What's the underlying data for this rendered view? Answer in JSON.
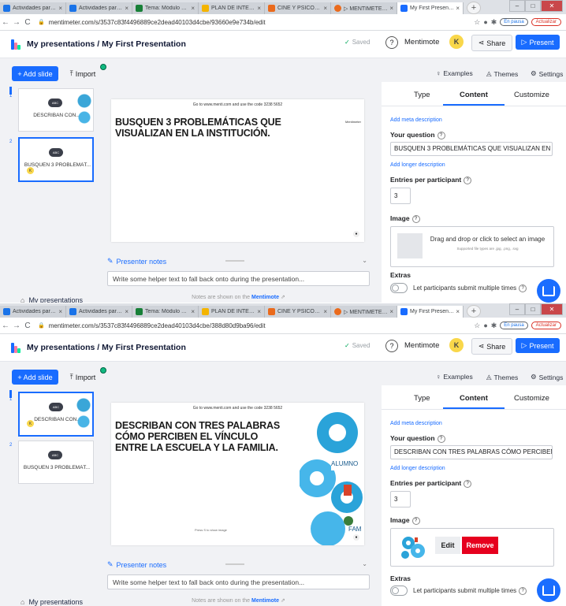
{
  "browser": {
    "tabs": [
      {
        "label": "Actividades para ...",
        "color": "#1a73e8"
      },
      {
        "label": "Actividades para ...",
        "color": "#1a73e8"
      },
      {
        "label": "Tema: Módulo 3 ...",
        "color": "#188038"
      },
      {
        "label": "PLAN DE INTERV...",
        "color": "#f4b400"
      },
      {
        "label": "CINE Y PSICOLOG...",
        "color": "#ea6a1c"
      },
      {
        "label": "▷ MENTIMETER ...",
        "color": "#ea6a1c"
      },
      {
        "label": "My First Presentat...",
        "color": "#196cff"
      }
    ],
    "paused_label": "En pausa",
    "update_label": "Actualizar"
  },
  "top": {
    "url": "mentimeter.com/s/3537c83f4496889ce2dead40103d4cbe/93660e9e734b/edit"
  },
  "bottom": {
    "url": "mentimeter.com/s/3537c83f4496889ce2dead40103d4cbe/388d80d9ba96/edit"
  },
  "app": {
    "breadcrumb": "My presentations / My First Presentation",
    "saved": "Saved",
    "mentimote": "Mentimote",
    "avatar": "K",
    "share": "Share",
    "present": "Present",
    "add_slide": "+ Add slide",
    "import": "Import",
    "examples": "Examples",
    "themes": "Themes",
    "settings": "Settings",
    "my_presentations": "My presentations"
  },
  "slides": {
    "n1": "1",
    "n2": "2",
    "thumb1_title": "DESCRIBAN CON...",
    "thumb2_title": "BUSQUEN 3 PROBLEMÁT...",
    "thumb_cloud": "ABC"
  },
  "canvas": {
    "code_line": "Go to www.menti.com and use the code 3238 5652",
    "brand": "Mentimeter",
    "top_question": "BUSQUEN 3 PROBLEMÁTICAS QUE VISUALIZAN EN LA INSTITUCIÓN.",
    "bottom_question": "DESCRIBAN CON TRES PALABRAS CÓMO PERCIBEN EL VÍNCULO ENTRE LA ESCUELA Y LA FAMILIA.",
    "art_label_1": "ALUMNO",
    "art_label_2": "FAM",
    "footer_note": "Press S to show image",
    "participants_icon": "person-icon"
  },
  "notes": {
    "heading": "Presenter notes",
    "placeholder": "Write some helper text to fall back onto during the presentation...",
    "info_prefix": "Notes are shown on the",
    "info_link": "Mentimote"
  },
  "panel": {
    "tab_type": "Type",
    "tab_content": "Content",
    "tab_customize": "Customize",
    "meta_link": "Add meta description",
    "question_label": "Your question",
    "top_question_value": "BUSQUEN 3 PROBLEMÁTICAS QUE VISUALIZAN EN L",
    "bottom_question_value": "DESCRIBAN CON TRES PALABRAS CÓMO PERCIBEN",
    "longer_link": "Add longer description",
    "entries_label": "Entries per participant",
    "entries_value": "3",
    "image_label": "Image",
    "drop_text": "Drag and drop or click to select an image",
    "drop_sub": "Supported file types are .jpg, .png, .svg",
    "edit": "Edit",
    "remove": "Remove",
    "extras_label": "Extras",
    "multi_label": "Let participants submit multiple times",
    "help_mark": "?"
  }
}
